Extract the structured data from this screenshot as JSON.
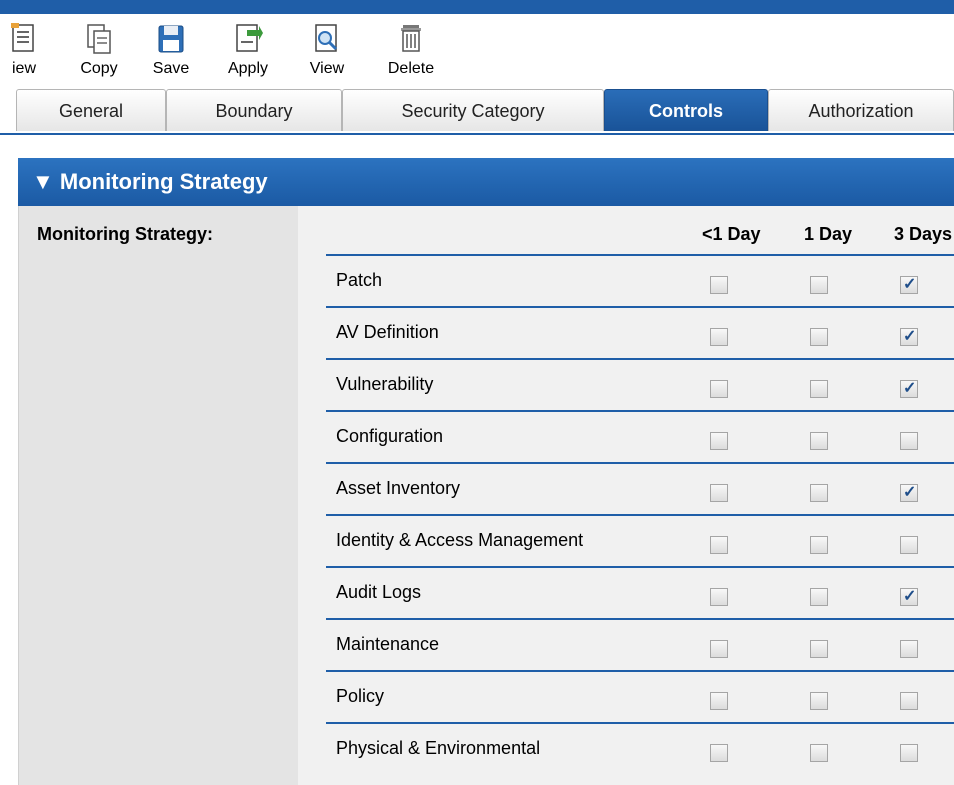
{
  "toolbar": {
    "items": [
      {
        "label": "iew",
        "icon": "new-document-icon"
      },
      {
        "label": "Copy",
        "icon": "copy-icon"
      },
      {
        "label": "Save",
        "icon": "save-icon"
      },
      {
        "label": "Apply",
        "icon": "apply-icon"
      },
      {
        "label": "View",
        "icon": "view-icon"
      },
      {
        "label": "Delete",
        "icon": "delete-icon"
      }
    ]
  },
  "tabs": [
    {
      "label": "General",
      "active": false
    },
    {
      "label": "Boundary",
      "active": false
    },
    {
      "label": "Security Category",
      "active": false
    },
    {
      "label": "Controls",
      "active": true
    },
    {
      "label": "Authorization",
      "active": false
    }
  ],
  "section": {
    "title": "▼ Monitoring Strategy",
    "field_label": "Monitoring Strategy:"
  },
  "table": {
    "columns": [
      "<1 Day",
      "1 Day",
      "3 Days"
    ],
    "rows": [
      {
        "name": "Patch",
        "checks": [
          false,
          false,
          true
        ]
      },
      {
        "name": "AV Definition",
        "checks": [
          false,
          false,
          true
        ]
      },
      {
        "name": "Vulnerability",
        "checks": [
          false,
          false,
          true
        ]
      },
      {
        "name": "Configuration",
        "checks": [
          false,
          false,
          false
        ]
      },
      {
        "name": "Asset Inventory",
        "checks": [
          false,
          false,
          true
        ]
      },
      {
        "name": "Identity & Access Management",
        "checks": [
          false,
          false,
          false
        ]
      },
      {
        "name": "Audit Logs",
        "checks": [
          false,
          false,
          true
        ]
      },
      {
        "name": "Maintenance",
        "checks": [
          false,
          false,
          false
        ]
      },
      {
        "name": "Policy",
        "checks": [
          false,
          false,
          false
        ]
      },
      {
        "name": "Physical & Environmental",
        "checks": [
          false,
          false,
          false
        ]
      }
    ]
  },
  "colors": {
    "accent": "#1f5ea8",
    "panel": "#e4e4e4"
  }
}
